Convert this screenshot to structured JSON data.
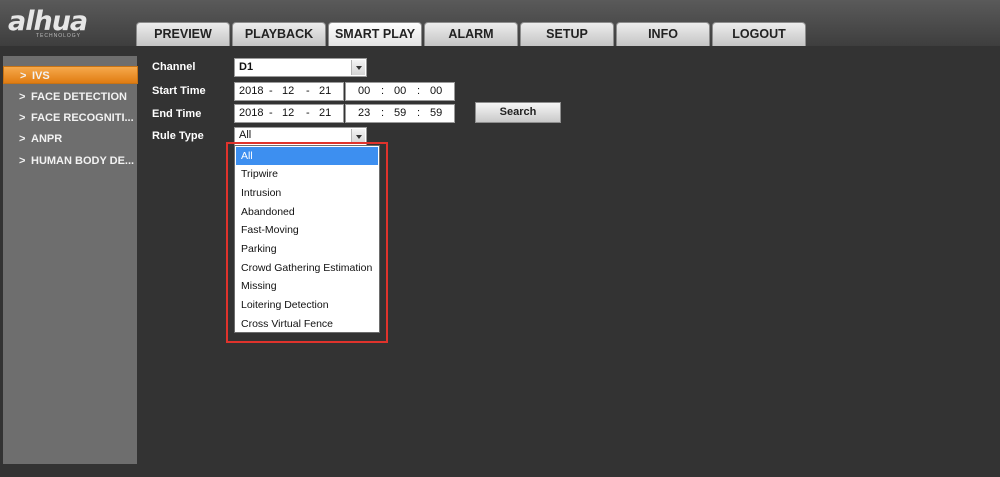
{
  "logo": {
    "text": "alhua",
    "subtext": "TECHNOLOGY"
  },
  "tabs": [
    {
      "label": "PREVIEW"
    },
    {
      "label": "PLAYBACK"
    },
    {
      "label": "SMART PLAY"
    },
    {
      "label": "ALARM"
    },
    {
      "label": "SETUP"
    },
    {
      "label": "INFO"
    },
    {
      "label": "LOGOUT"
    }
  ],
  "active_tab": "SMART PLAY",
  "sidebar": {
    "items": [
      {
        "label": "IVS",
        "active": true
      },
      {
        "label": "FACE DETECTION"
      },
      {
        "label": "FACE RECOGNITI..."
      },
      {
        "label": "ANPR"
      },
      {
        "label": "HUMAN BODY DE..."
      }
    ],
    "chevron": ">"
  },
  "form": {
    "channel_label": "Channel",
    "channel_value": "D1",
    "start_label": "Start Time",
    "start_date": {
      "year": "2018",
      "month": "12",
      "day": "21"
    },
    "start_time": {
      "hour": "00",
      "minute": "00",
      "second": "00"
    },
    "end_label": "End Time",
    "end_date": {
      "year": "2018",
      "month": "12",
      "day": "21"
    },
    "end_time": {
      "hour": "23",
      "minute": "59",
      "second": "59"
    },
    "date_sep": "-",
    "time_sep": ":",
    "search_label": "Search",
    "rule_type_label": "Rule Type",
    "rule_type_value": "All"
  },
  "rule_options": [
    "All",
    "Tripwire",
    "Intrusion",
    "Abandoned",
    "Fast-Moving",
    "Parking",
    "Crowd Gathering Estimation",
    "Missing",
    "Loitering Detection",
    "Cross Virtual Fence"
  ],
  "colors": {
    "active_orange": "#e88a1e",
    "selected_blue": "#3d8ff0",
    "highlight_red": "#e0332c"
  }
}
